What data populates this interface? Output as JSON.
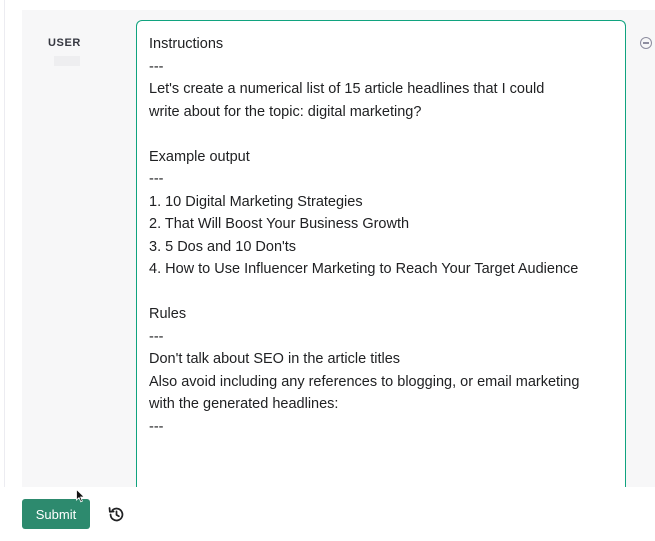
{
  "message": {
    "role_label": "USER",
    "lines": [
      "Instructions",
      "---",
      "Let's create a numerical list of 15 article headlines that I could",
      "write about for the topic: digital marketing?",
      "",
      "Example output",
      "---",
      "1. 10 Digital Marketing Strategies",
      "2. That Will Boost Your Business Growth",
      "3. 5 Dos and 10 Don'ts",
      "4. How to Use Influencer Marketing to Reach Your Target Audience",
      "",
      "Rules",
      "---",
      "Don't talk about SEO in the article titles",
      "Also avoid including any references to blogging, or email marketing",
      "with the generated headlines:",
      "---"
    ]
  },
  "footer": {
    "submit_label": "Submit"
  },
  "icons": {
    "remove": "minus-circle-icon",
    "history": "history-icon",
    "cursor": "mouse-pointer-icon"
  },
  "colors": {
    "accent": "#10a37f",
    "submit_bg": "#2d8a6e",
    "row_bg": "#f7f7f8",
    "text": "#202123"
  }
}
